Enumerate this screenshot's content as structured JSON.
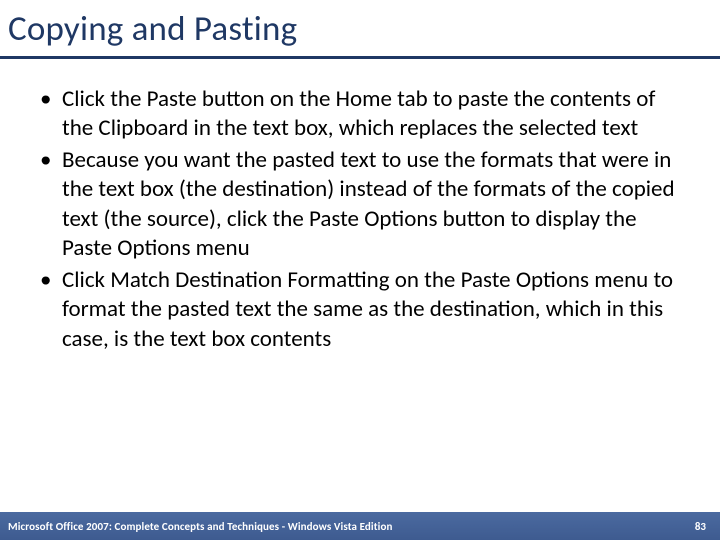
{
  "title": "Copying and Pasting",
  "bullets": [
    "Click the Paste button on the Home tab to paste the contents of the Clipboard in the text box, which replaces the selected text",
    "Because you want the pasted text to use the formats that were in the text box (the destination) instead of the formats of the copied text (the source), click the Paste Options button to display the Paste Options menu",
    "Click Match Destination Formatting on the Paste Options menu to format the pasted text the same as the destination, which in this case, is the text box contents"
  ],
  "footer": {
    "left": "Microsoft Office 2007: Complete Concepts and Techniques - Windows Vista Edition",
    "page": "83"
  }
}
